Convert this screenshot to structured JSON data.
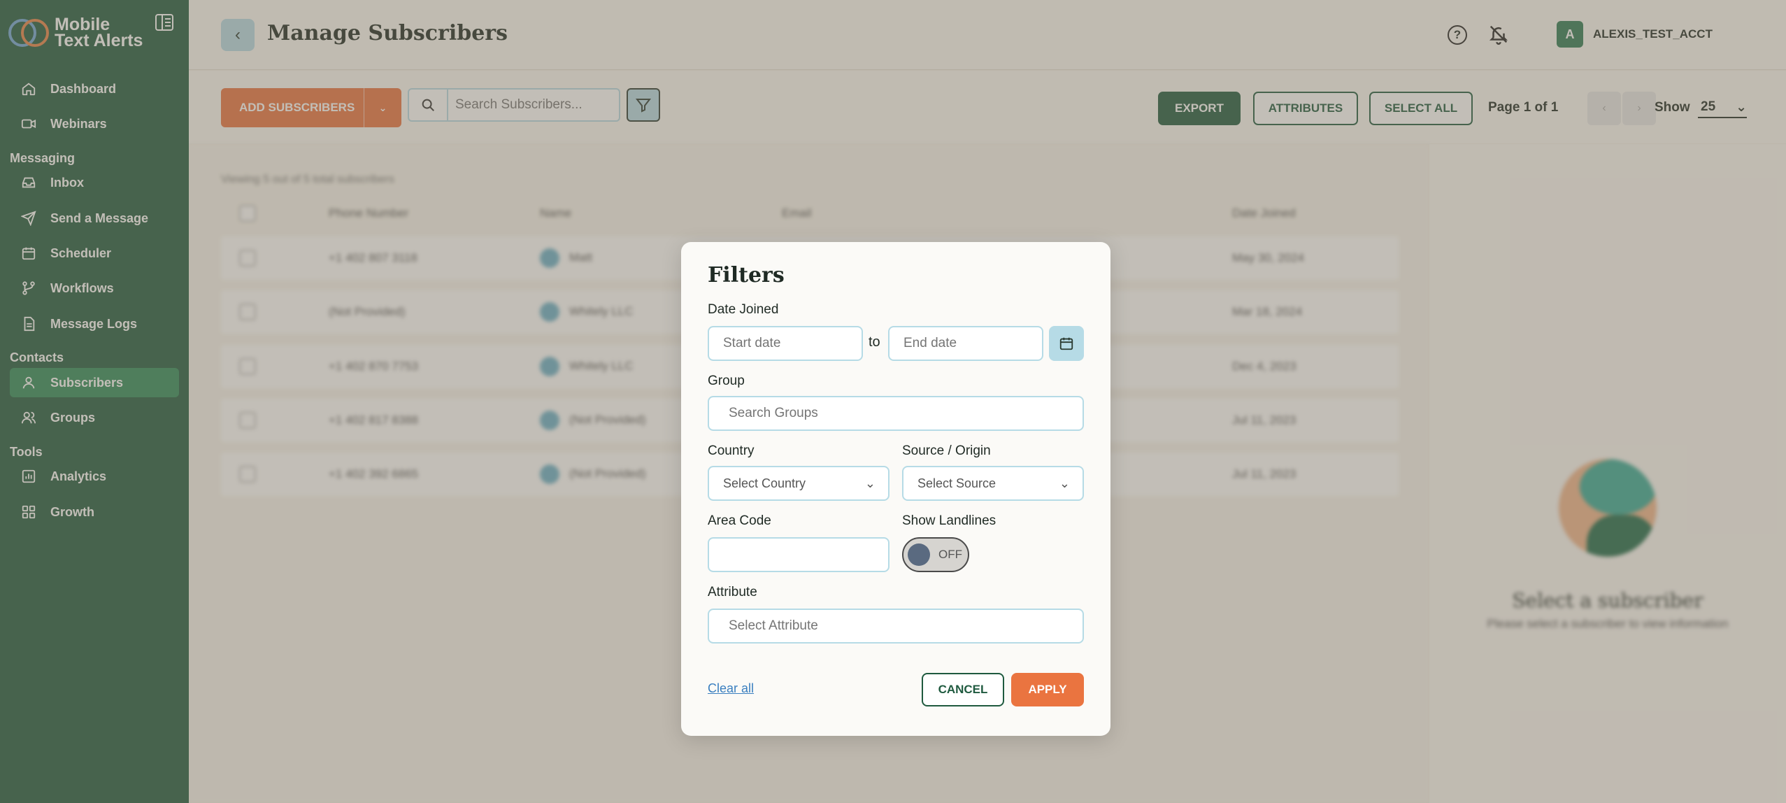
{
  "app": {
    "logo_line1": "Mobile",
    "logo_line2": "Text Alerts"
  },
  "sidebar": {
    "items_top": [
      {
        "label": "Dashboard",
        "icon": "home-icon"
      },
      {
        "label": "Webinars",
        "icon": "video-icon"
      }
    ],
    "section_messaging": "Messaging",
    "items_messaging": [
      {
        "label": "Inbox",
        "icon": "inbox-icon"
      },
      {
        "label": "Send a Message",
        "icon": "send-icon"
      },
      {
        "label": "Scheduler",
        "icon": "calendar-icon"
      },
      {
        "label": "Workflows",
        "icon": "workflow-icon"
      },
      {
        "label": "Message Logs",
        "icon": "document-icon"
      }
    ],
    "section_contacts": "Contacts",
    "items_contacts": [
      {
        "label": "Subscribers",
        "icon": "user-icon",
        "active": true
      },
      {
        "label": "Groups",
        "icon": "users-icon"
      }
    ],
    "section_tools": "Tools",
    "items_tools": [
      {
        "label": "Analytics",
        "icon": "analytics-icon"
      },
      {
        "label": "Growth",
        "icon": "grid-icon"
      }
    ]
  },
  "header": {
    "title": "Manage Subscribers",
    "account_initial": "A",
    "account_name": "ALEXIS_TEST_ACCT"
  },
  "toolbar": {
    "add_label": "ADD SUBSCRIBERS",
    "search_placeholder": "Search Subscribers...",
    "export_label": "EXPORT",
    "attributes_label": "ATTRIBUTES",
    "select_all_label": "SELECT ALL",
    "page_text": "Page 1 of 1",
    "show_label": "Show",
    "show_value": "25"
  },
  "table": {
    "count_text": "Viewing 5 out of 5 total subscribers",
    "columns": [
      "Phone Number",
      "Name",
      "Email",
      "Date Joined"
    ],
    "rows": [
      {
        "phone": "+1 402 807 3118",
        "name": "Matt",
        "date": "May 30, 2024"
      },
      {
        "phone": "(Not Provided)",
        "name": "Whitely LLC",
        "date": "Mar 18, 2024"
      },
      {
        "phone": "+1 402 870 7753",
        "name": "Whitely LLC",
        "date": "Dec 4, 2023"
      },
      {
        "phone": "+1 402 817 8388",
        "name": "(Not Provided)",
        "date": "Jul 11, 2023"
      },
      {
        "phone": "+1 402 392 6865",
        "name": "(Not Provided)",
        "date": "Jul 11, 2023"
      }
    ]
  },
  "detail": {
    "empty_title": "Select a subscriber",
    "empty_sub": "Please select a subscriber to view information"
  },
  "filters": {
    "title": "Filters",
    "date_joined_label": "Date Joined",
    "start_placeholder": "Start date",
    "to_text": "to",
    "end_placeholder": "End date",
    "group_label": "Group",
    "group_placeholder": "Search Groups",
    "country_label": "Country",
    "country_value": "Select Country",
    "source_label": "Source / Origin",
    "source_value": "Select Source",
    "area_code_label": "Area Code",
    "area_code_value": "",
    "landlines_label": "Show Landlines",
    "landlines_state": "OFF",
    "attribute_label": "Attribute",
    "attribute_placeholder": "Select Attribute",
    "clear_label": "Clear all",
    "cancel_label": "CANCEL",
    "apply_label": "APPLY"
  },
  "colors": {
    "sidebar_bg": "#1f5a3f",
    "accent_orange": "#ea7440",
    "accent_blue": "#b6dbe6",
    "active_item": "#2e8a5a"
  }
}
